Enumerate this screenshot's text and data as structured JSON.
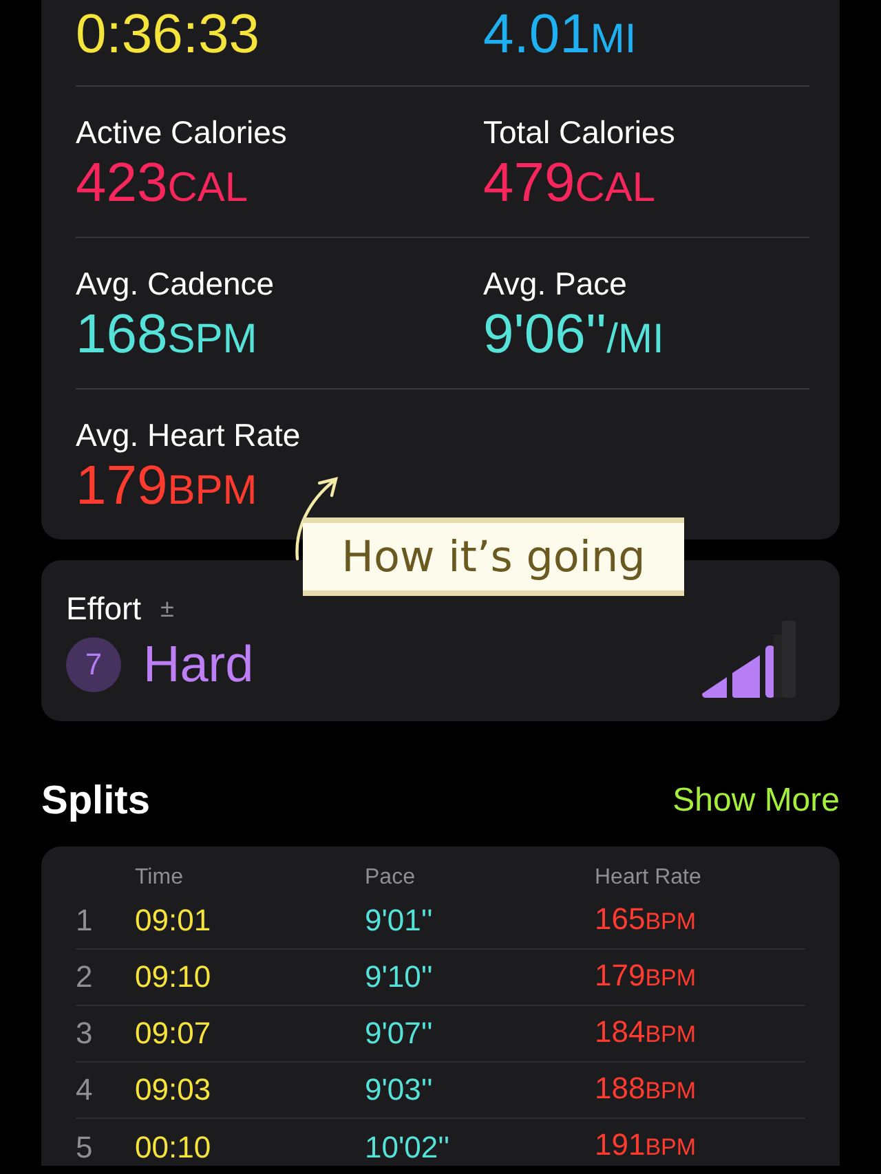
{
  "metrics": [
    {
      "value": "0:36:33",
      "color": "#f5e43a"
    },
    {
      "value": "4.01",
      "unit": "MI",
      "color": "#1fb0f2"
    },
    {
      "label": "Active Calories",
      "value": "423",
      "unit": "CAL",
      "color": "#f7265c"
    },
    {
      "label": "Total Calories",
      "value": "479",
      "unit": "CAL",
      "color": "#f7265c"
    },
    {
      "label": "Avg. Cadence",
      "value": "168",
      "unit": "SPM",
      "color": "#55e2d9"
    },
    {
      "label": "Avg. Pace",
      "value": "9'06''",
      "unit": "/MI",
      "color": "#55e2d9"
    },
    {
      "label": "Avg. Heart Rate",
      "value": "179",
      "unit": "BPM",
      "color": "#ff3b30"
    }
  ],
  "annotation": {
    "text": "How it’s going"
  },
  "effort": {
    "label": "Effort",
    "toggle": "±",
    "score": "7",
    "rating": "Hard"
  },
  "splits": {
    "title": "Splits",
    "action": "Show More",
    "columns": [
      "Time",
      "Pace",
      "Heart Rate"
    ],
    "rows": [
      {
        "index": "1",
        "time": "09:01",
        "pace": "9'01''",
        "heart_rate": "165",
        "unit": "BPM"
      },
      {
        "index": "2",
        "time": "09:10",
        "pace": "9'10''",
        "heart_rate": "179",
        "unit": "BPM"
      },
      {
        "index": "3",
        "time": "09:07",
        "pace": "9'07''",
        "heart_rate": "184",
        "unit": "BPM"
      },
      {
        "index": "4",
        "time": "09:03",
        "pace": "9'03''",
        "heart_rate": "188",
        "unit": "BPM"
      },
      {
        "index": "5",
        "time": "00:10",
        "pace": "10'02''",
        "heart_rate": "191",
        "unit": "BPM"
      }
    ]
  }
}
